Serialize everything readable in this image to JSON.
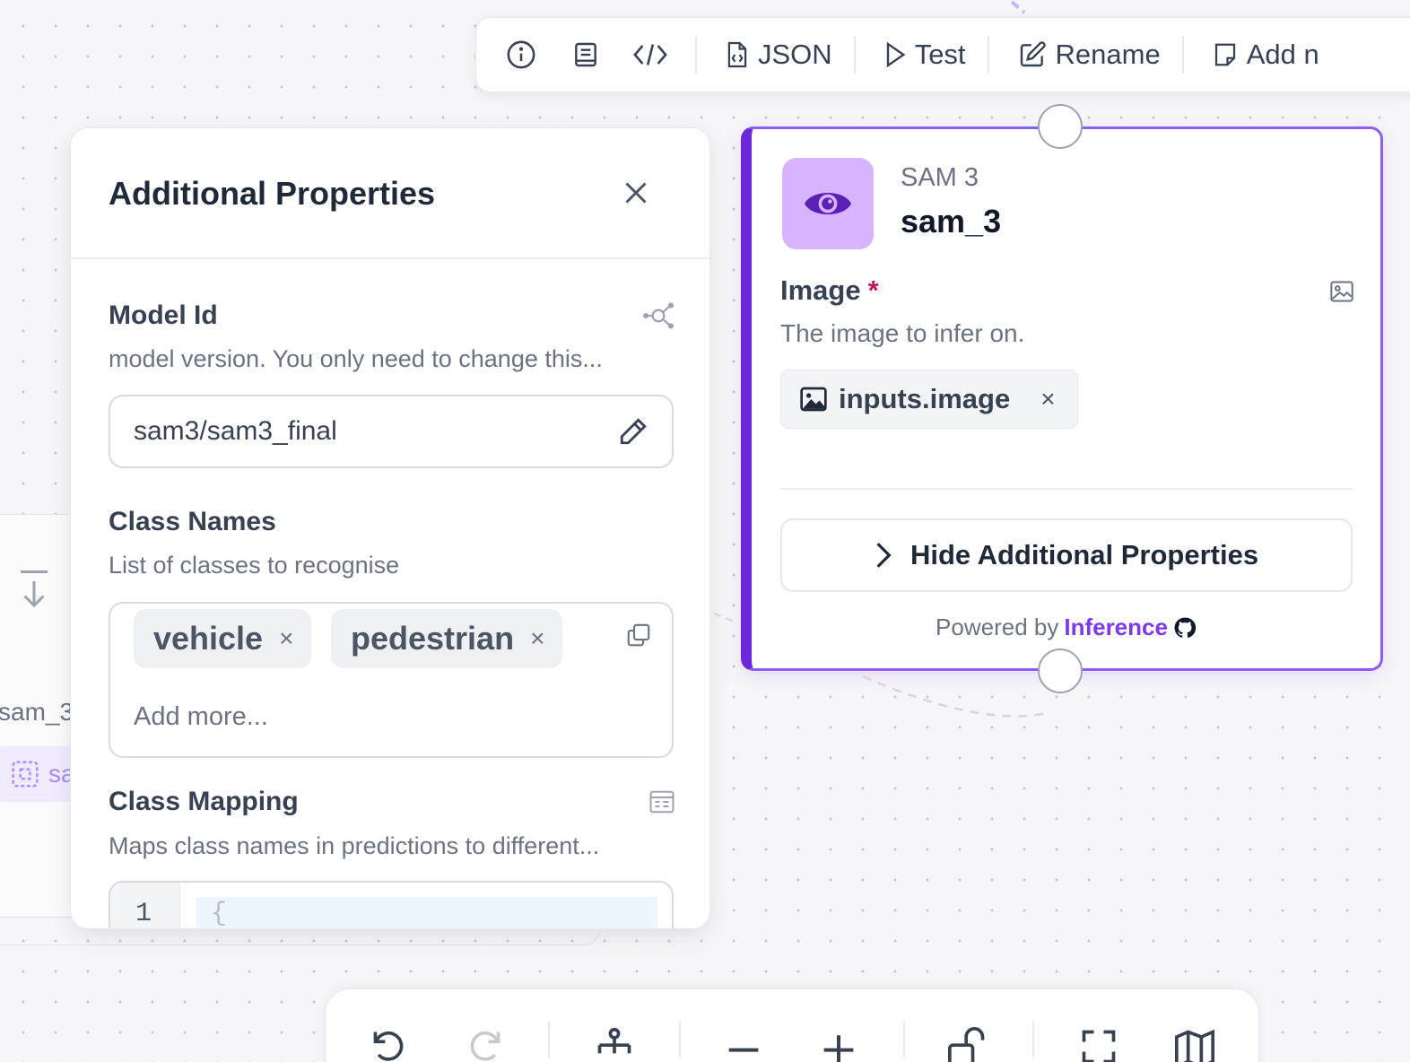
{
  "top_toolbar": {
    "json_label": "JSON",
    "test_label": "Test",
    "rename_label": "Rename",
    "add_label": "Add n"
  },
  "ghost_node": {
    "name": "sam_3",
    "chip": "sa"
  },
  "panel": {
    "title": "Additional Properties",
    "model_id": {
      "label": "Model Id",
      "description": "model version. You only need to change this...",
      "value": "sam3/sam3_final"
    },
    "class_names": {
      "label": "Class Names",
      "description": "List of classes to recognise",
      "tags": [
        "vehicle",
        "pedestrian"
      ],
      "remove_glyph": "×",
      "add_placeholder": "Add more..."
    },
    "class_mapping": {
      "label": "Class Mapping",
      "description": "Maps class names in predictions to different...",
      "line_number": "1",
      "code_first_line": "{"
    }
  },
  "node": {
    "type": "SAM 3",
    "name": "sam_3",
    "image_field": {
      "label": "Image",
      "required_mark": "*",
      "description": "The image to infer on.",
      "value": "inputs.image",
      "remove_glyph": "×"
    },
    "toggle_label": "Hide Additional Properties",
    "powered_by": "Powered by",
    "powered_link": "Inference"
  },
  "colors": {
    "accent": "#7c3aed",
    "node_border": "#8b5cf6",
    "icon_bg": "#d8b4fe",
    "icon_fg": "#5b21b6"
  }
}
